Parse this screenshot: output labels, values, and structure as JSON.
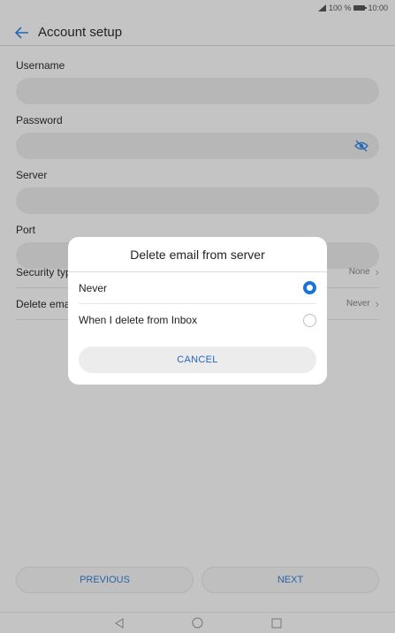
{
  "status_bar": {
    "battery": "100 %",
    "time": "10:00"
  },
  "app_bar": {
    "title": "Account setup"
  },
  "form": {
    "username_label": "Username",
    "password_label": "Password",
    "server_label": "Server",
    "port_label": "Port"
  },
  "prefs": {
    "security_label": "Security typ",
    "security_value": "None",
    "delete_label": "Delete emai",
    "delete_value": "Never"
  },
  "dialog": {
    "title": "Delete email from server",
    "options": [
      {
        "label": "Never",
        "selected": true
      },
      {
        "label": "When I delete from Inbox",
        "selected": false
      }
    ],
    "cancel_label": "CANCEL"
  },
  "footer": {
    "previous_label": "PREVIOUS",
    "next_label": "NEXT"
  },
  "colors": {
    "accent": "#1a73d9",
    "link": "#2468b6",
    "scrim_bg": "#c4c4c4"
  },
  "icons": {
    "back": "arrow-left-icon",
    "password_toggle": "eye-off-icon"
  }
}
